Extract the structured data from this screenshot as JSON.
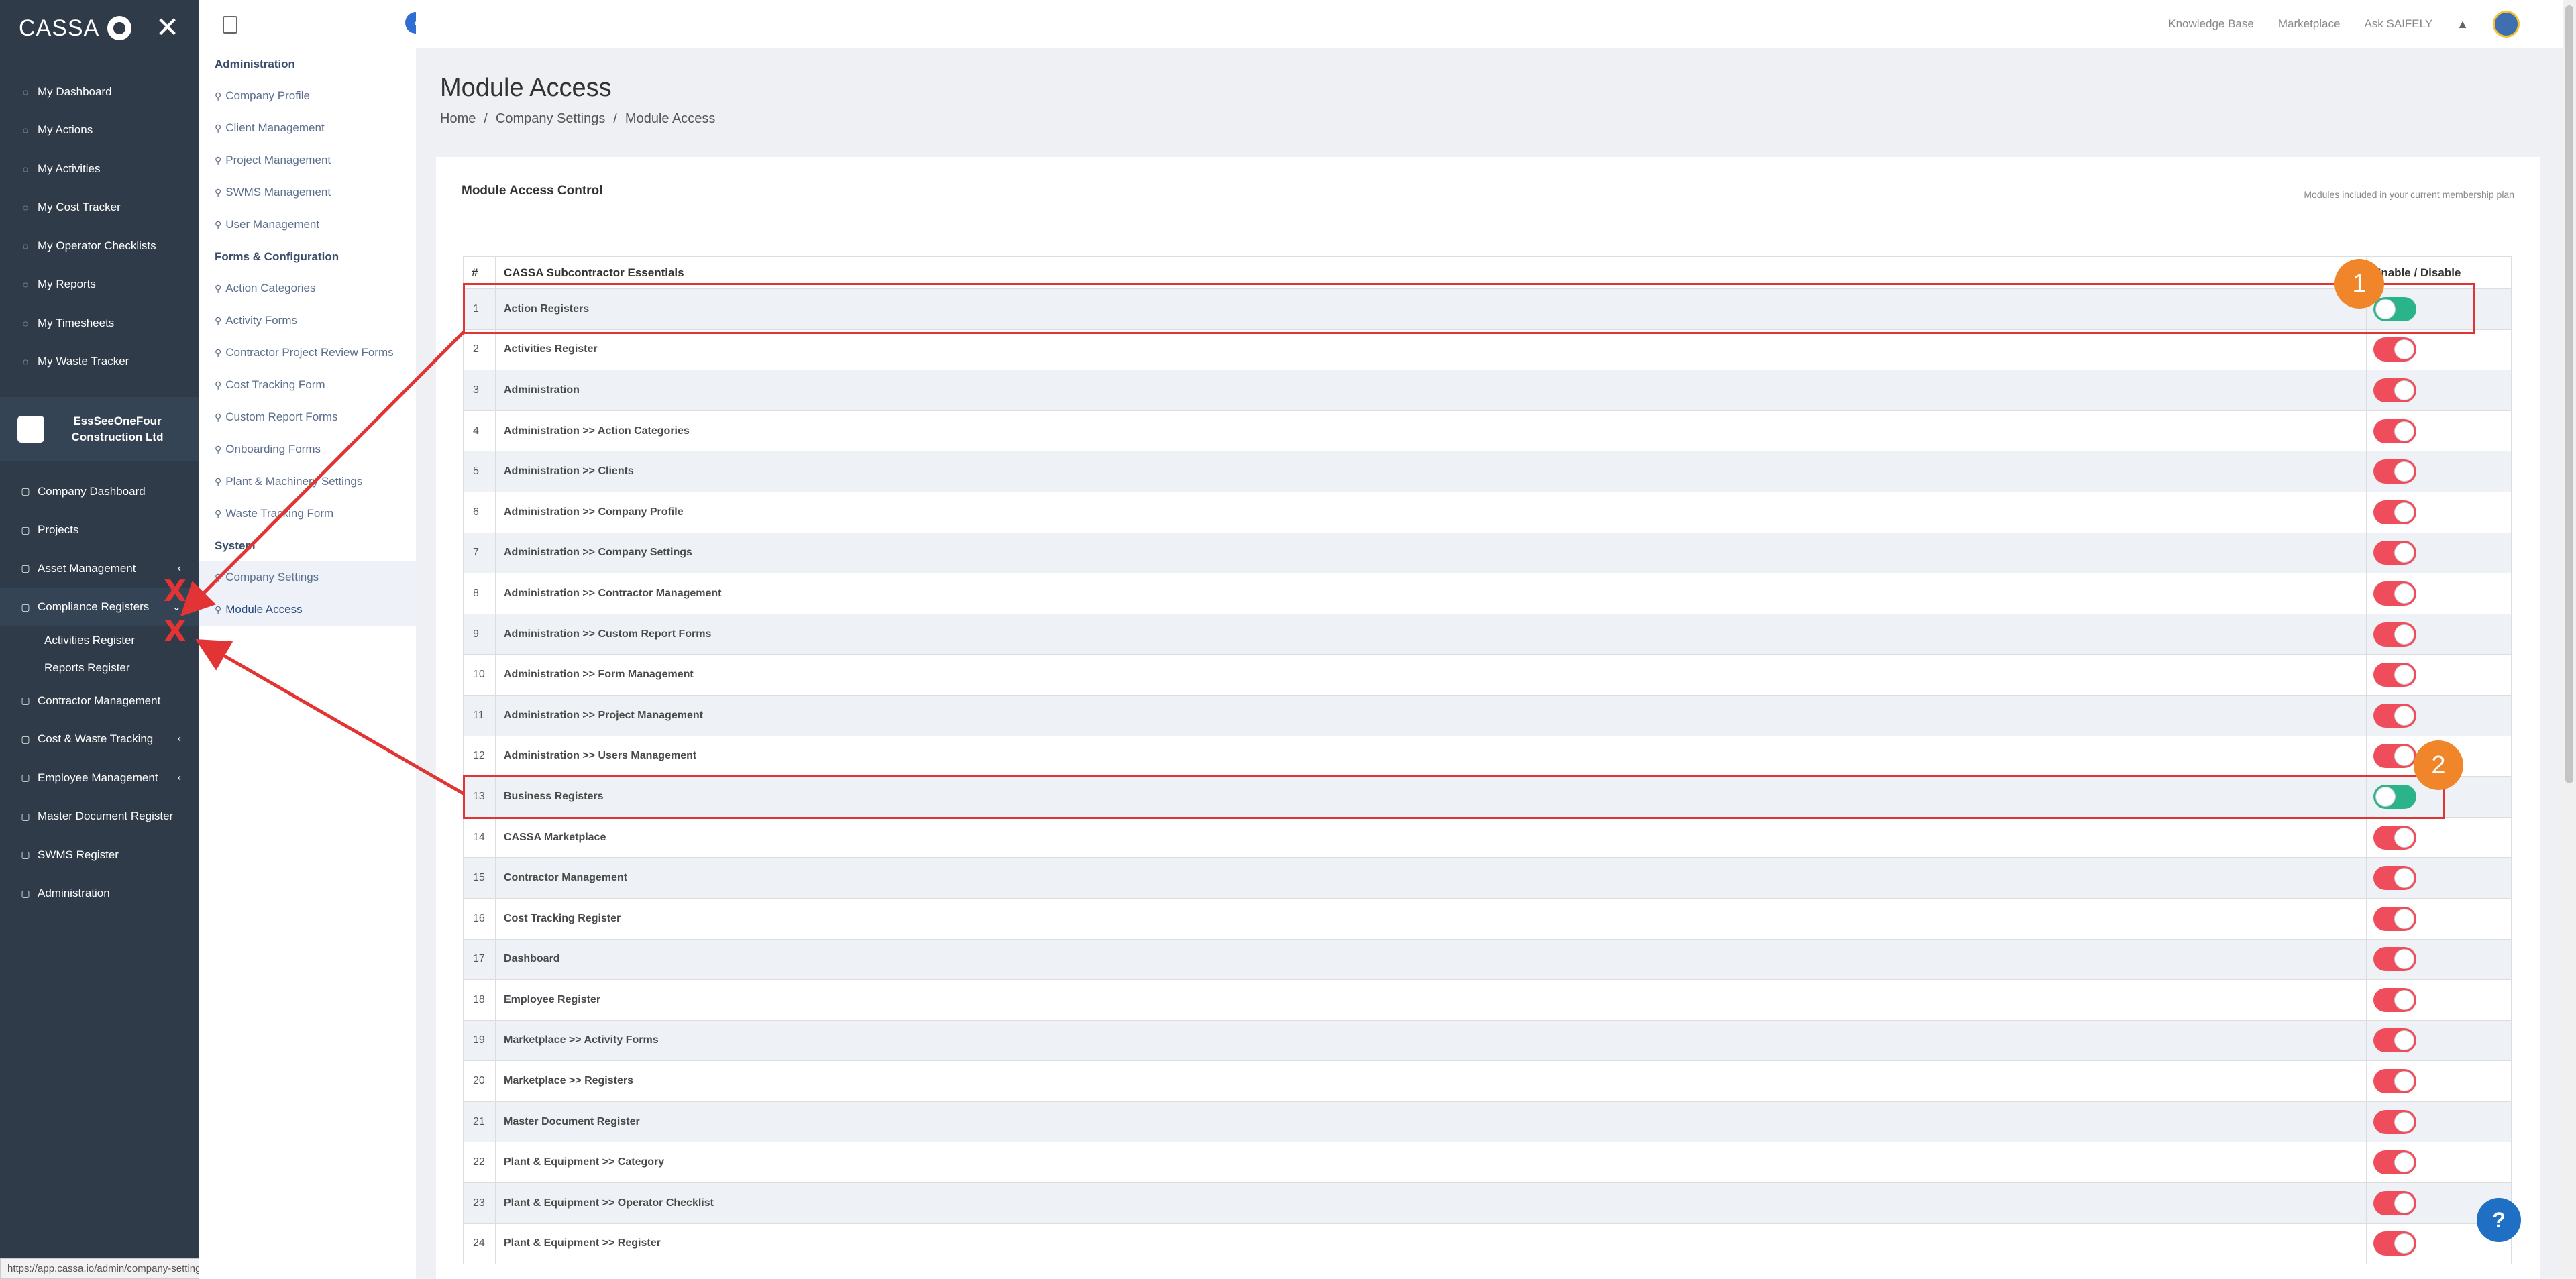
{
  "nav": {
    "brand": "CASSA",
    "items": [
      {
        "label": "My Dashboard",
        "icon": "dashboard-icon"
      },
      {
        "label": "My Actions",
        "icon": "actions-icon"
      },
      {
        "label": "My Activities",
        "icon": "activities-icon"
      },
      {
        "label": "My Cost Tracker",
        "icon": "cost-icon"
      },
      {
        "label": "My Operator Checklists",
        "icon": "checklist-icon"
      },
      {
        "label": "My Reports",
        "icon": "reports-icon"
      },
      {
        "label": "My Timesheets",
        "icon": "timesheet-icon"
      },
      {
        "label": "My Waste Tracker",
        "icon": "waste-icon"
      }
    ],
    "company_name": "EssSeeOneFour Construction Ltd",
    "company_items": [
      {
        "label": "Company Dashboard"
      },
      {
        "label": "Projects"
      },
      {
        "label": "Asset Management"
      },
      {
        "label": "Compliance Registers"
      },
      {
        "label": "Activities Register"
      },
      {
        "label": "Reports Register"
      },
      {
        "label": "Contractor Management"
      },
      {
        "label": "Cost & Waste Tracking"
      },
      {
        "label": "Employee Management"
      },
      {
        "label": "Master Document Register"
      },
      {
        "label": "SWMS Register"
      },
      {
        "label": "Administration"
      }
    ]
  },
  "status_url": "https://app.cassa.io/admin/company-setting/index",
  "sidebar": {
    "sections": [
      {
        "title": "Administration",
        "items": [
          "Company Profile",
          "Client Management",
          "Project Management",
          "SWMS Management",
          "User Management"
        ]
      },
      {
        "title": "Forms & Configuration",
        "items": [
          "Action Categories",
          "Activity Forms",
          "Contractor Project Review Forms",
          "Cost Tracking Form",
          "Custom Report Forms",
          "Onboarding Forms",
          "Plant & Machinery Settings",
          "Waste Tracking Form"
        ]
      },
      {
        "title": "System",
        "items": [
          "Company Settings",
          "Module Access"
        ]
      }
    ]
  },
  "topbar": {
    "knowledge_base": "Knowledge Base",
    "marketplace": "Marketplace",
    "ask": "Ask SAIFELY"
  },
  "page": {
    "title": "Module Access",
    "breadcrumb": [
      "Home",
      "Company Settings",
      "Module Access"
    ]
  },
  "card": {
    "title": "Module Access Control",
    "note": "Modules included in your current membership plan",
    "columns": [
      "#",
      "CASSA Subcontractor Essentials",
      "Enable / Disable"
    ],
    "rows": [
      {
        "n": "1",
        "name": "Action Registers",
        "on": true
      },
      {
        "n": "2",
        "name": "Activities Register",
        "on": false
      },
      {
        "n": "3",
        "name": "Administration",
        "on": false
      },
      {
        "n": "4",
        "name": "Administration >> Action Categories",
        "on": false
      },
      {
        "n": "5",
        "name": "Administration >> Clients",
        "on": false
      },
      {
        "n": "6",
        "name": "Administration >> Company Profile",
        "on": false
      },
      {
        "n": "7",
        "name": "Administration >> Company Settings",
        "on": false
      },
      {
        "n": "8",
        "name": "Administration >> Contractor Management",
        "on": false
      },
      {
        "n": "9",
        "name": "Administration >> Custom Report Forms",
        "on": false
      },
      {
        "n": "10",
        "name": "Administration >> Form Management",
        "on": false
      },
      {
        "n": "11",
        "name": "Administration >> Project Management",
        "on": false
      },
      {
        "n": "12",
        "name": "Administration >> Users Management",
        "on": false
      },
      {
        "n": "13",
        "name": "Business Registers",
        "on": true
      },
      {
        "n": "14",
        "name": "CASSA Marketplace",
        "on": false
      },
      {
        "n": "15",
        "name": "Contractor Management",
        "on": false
      },
      {
        "n": "16",
        "name": "Cost Tracking Register",
        "on": false
      },
      {
        "n": "17",
        "name": "Dashboard",
        "on": false
      },
      {
        "n": "18",
        "name": "Employee Register",
        "on": false
      },
      {
        "n": "19",
        "name": "Marketplace >> Activity Forms",
        "on": false
      },
      {
        "n": "20",
        "name": "Marketplace >> Registers",
        "on": false
      },
      {
        "n": "21",
        "name": "Master Document Register",
        "on": false
      },
      {
        "n": "22",
        "name": "Plant & Equipment >> Category",
        "on": false
      },
      {
        "n": "23",
        "name": "Plant & Equipment >> Operator Checklist",
        "on": false
      },
      {
        "n": "24",
        "name": "Plant & Equipment >> Register",
        "on": false
      }
    ]
  },
  "annotations": {
    "badge1": "1",
    "badge2": "2",
    "x": "X"
  },
  "help_icon": "?"
}
